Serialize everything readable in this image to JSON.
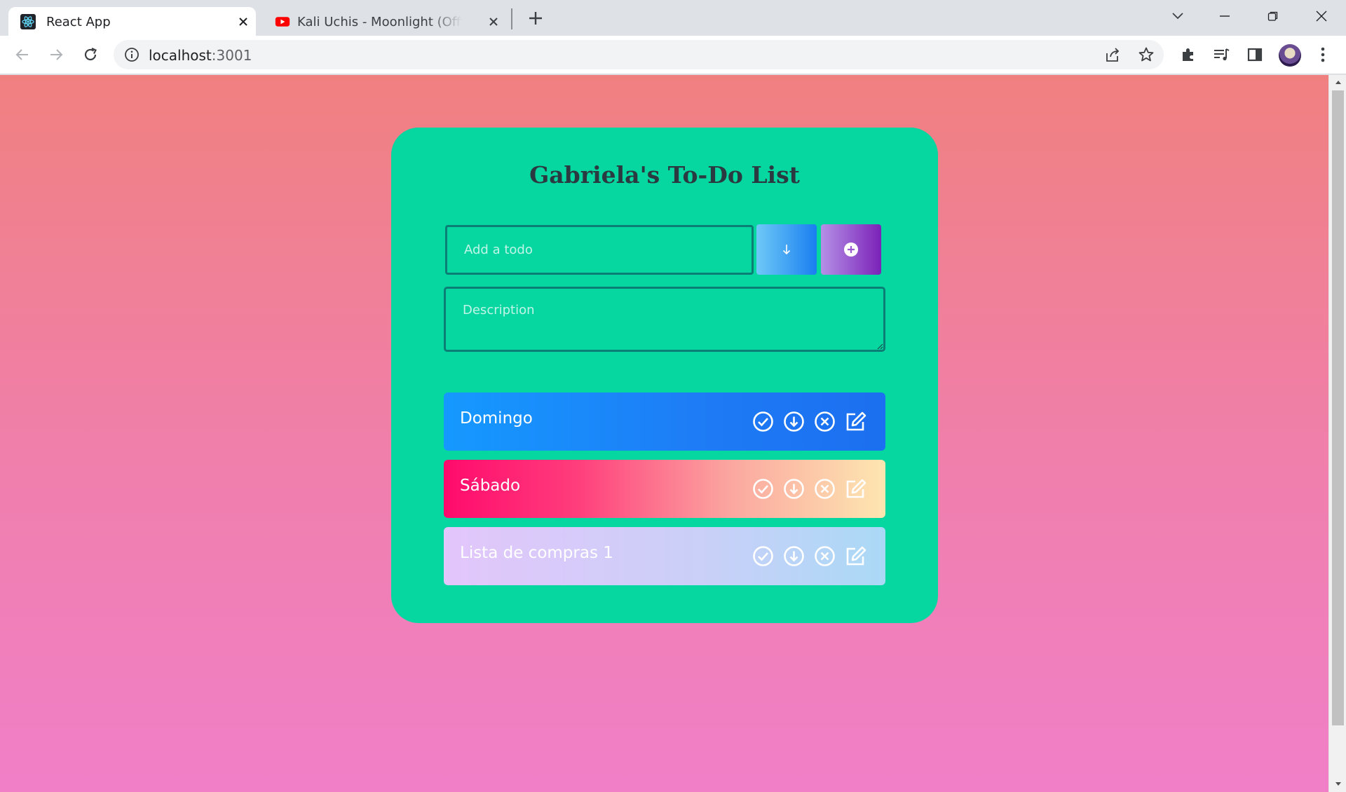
{
  "browser": {
    "tabs": [
      {
        "title": "React App",
        "active": true,
        "favicon": "react-icon"
      },
      {
        "title": "Kali Uchis - Moonlight (Official Lyric Video)",
        "active": false,
        "favicon": "youtube-icon"
      }
    ],
    "url_host": "localhost",
    "url_port": ":3001"
  },
  "app": {
    "title": "Gabriela's To-Do List",
    "todo_placeholder": "Add a todo",
    "description_placeholder": "Description",
    "todos": [
      {
        "text": "Domingo"
      },
      {
        "text": "Sábado"
      },
      {
        "text": "Lista de compras 1"
      }
    ]
  },
  "colors": {
    "card": "#06d6a0",
    "border": "#0b7e75",
    "title_text": "#2b3a40"
  }
}
